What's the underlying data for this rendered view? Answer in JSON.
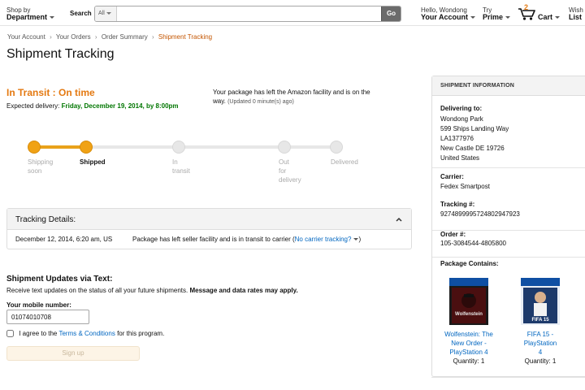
{
  "header": {
    "shop_by_line1": "Shop by",
    "shop_by_line2": "Department",
    "search_label": "Search",
    "search_category": "All",
    "search_value": "",
    "search_button": "Go",
    "account_line1": "Hello, Wondong",
    "account_line2": "Your Account",
    "prime_line1": "Try",
    "prime_line2": "Prime",
    "cart_count": "2",
    "cart_label": "Cart",
    "wish_line1": "Wish",
    "wish_line2": "List"
  },
  "breadcrumb": {
    "items": [
      "Your Account",
      "Your Orders",
      "Order Summary"
    ],
    "current": "Shipment Tracking",
    "separator": "›"
  },
  "page_title": "Shipment Tracking",
  "status": {
    "title": "In Transit : On time",
    "expected_label": "Expected delivery:",
    "expected_date": "Friday, December 19, 2014, by 8:00pm",
    "message": "Your package has left the Amazon facility and is on the way.",
    "updated": "(Updated 0 minute(s) ago)"
  },
  "progress": {
    "completed_fraction": 0.19,
    "steps": [
      {
        "label_line1": "Shipping",
        "label_line2": "soon",
        "label_line3": "",
        "done": true,
        "active": false
      },
      {
        "label_line1": "Shipped",
        "label_line2": "",
        "label_line3": "",
        "done": true,
        "active": true
      },
      {
        "label_line1": "In",
        "label_line2": "transit",
        "label_line3": "",
        "done": false,
        "active": false
      },
      {
        "label_line1": "Out",
        "label_line2": "for",
        "label_line3": "delivery",
        "done": false,
        "active": false
      },
      {
        "label_line1": "Delivered",
        "label_line2": "",
        "label_line3": "",
        "done": false,
        "active": false
      }
    ]
  },
  "tracking": {
    "title": "Tracking Details:",
    "rows": [
      {
        "datetime": "December 12, 2014, 6:20 am, US",
        "description": "Package has left seller facility and is in transit to carrier",
        "link": "No carrier tracking?"
      }
    ]
  },
  "sms": {
    "title": "Shipment Updates via Text:",
    "desc": "Receive text updates on the status of all your future shipments.",
    "desc_bold": "Message and data rates may apply.",
    "mobile_label": "Your mobile number:",
    "mobile_value": "01074010708",
    "agree_prefix": "I agree to the",
    "agree_link": "Terms & Conditions",
    "agree_suffix": "for this program.",
    "signup_label": "Sign up"
  },
  "panel": {
    "title": "SHIPMENT INFORMATION",
    "delivering_label": "Delivering to:",
    "address": [
      "Wondong Park",
      "599 Ships Landing Way",
      "LA1377976",
      "New Castle DE 19726",
      "United States"
    ],
    "carrier_label": "Carrier:",
    "carrier": "Fedex Smartpost",
    "tracking_label": "Tracking #:",
    "tracking_number": "9274899995724802947923",
    "order_label": "Order #:",
    "order_number": "105-3084544-4805800",
    "contains_label": "Package Contains:",
    "products": [
      {
        "name_line1": "Wolfenstein: The",
        "name_line2": "New Order -",
        "name_line3": "PlayStation 4",
        "qty": "Quantity: 1",
        "cover_text": "Wolfenstein",
        "cover_color": "#4a0f10"
      },
      {
        "name_line1": "FIFA 15 - PlayStation",
        "name_line2": "4",
        "name_line3": "",
        "qty": "Quantity: 1",
        "cover_text": "FIFA 15",
        "cover_color": "#1d3a6b"
      }
    ]
  },
  "colors": {
    "accent_orange": "#e47911",
    "progress_orange": "#f0a215",
    "delivery_green": "#007600",
    "link_blue": "#0066c0"
  }
}
